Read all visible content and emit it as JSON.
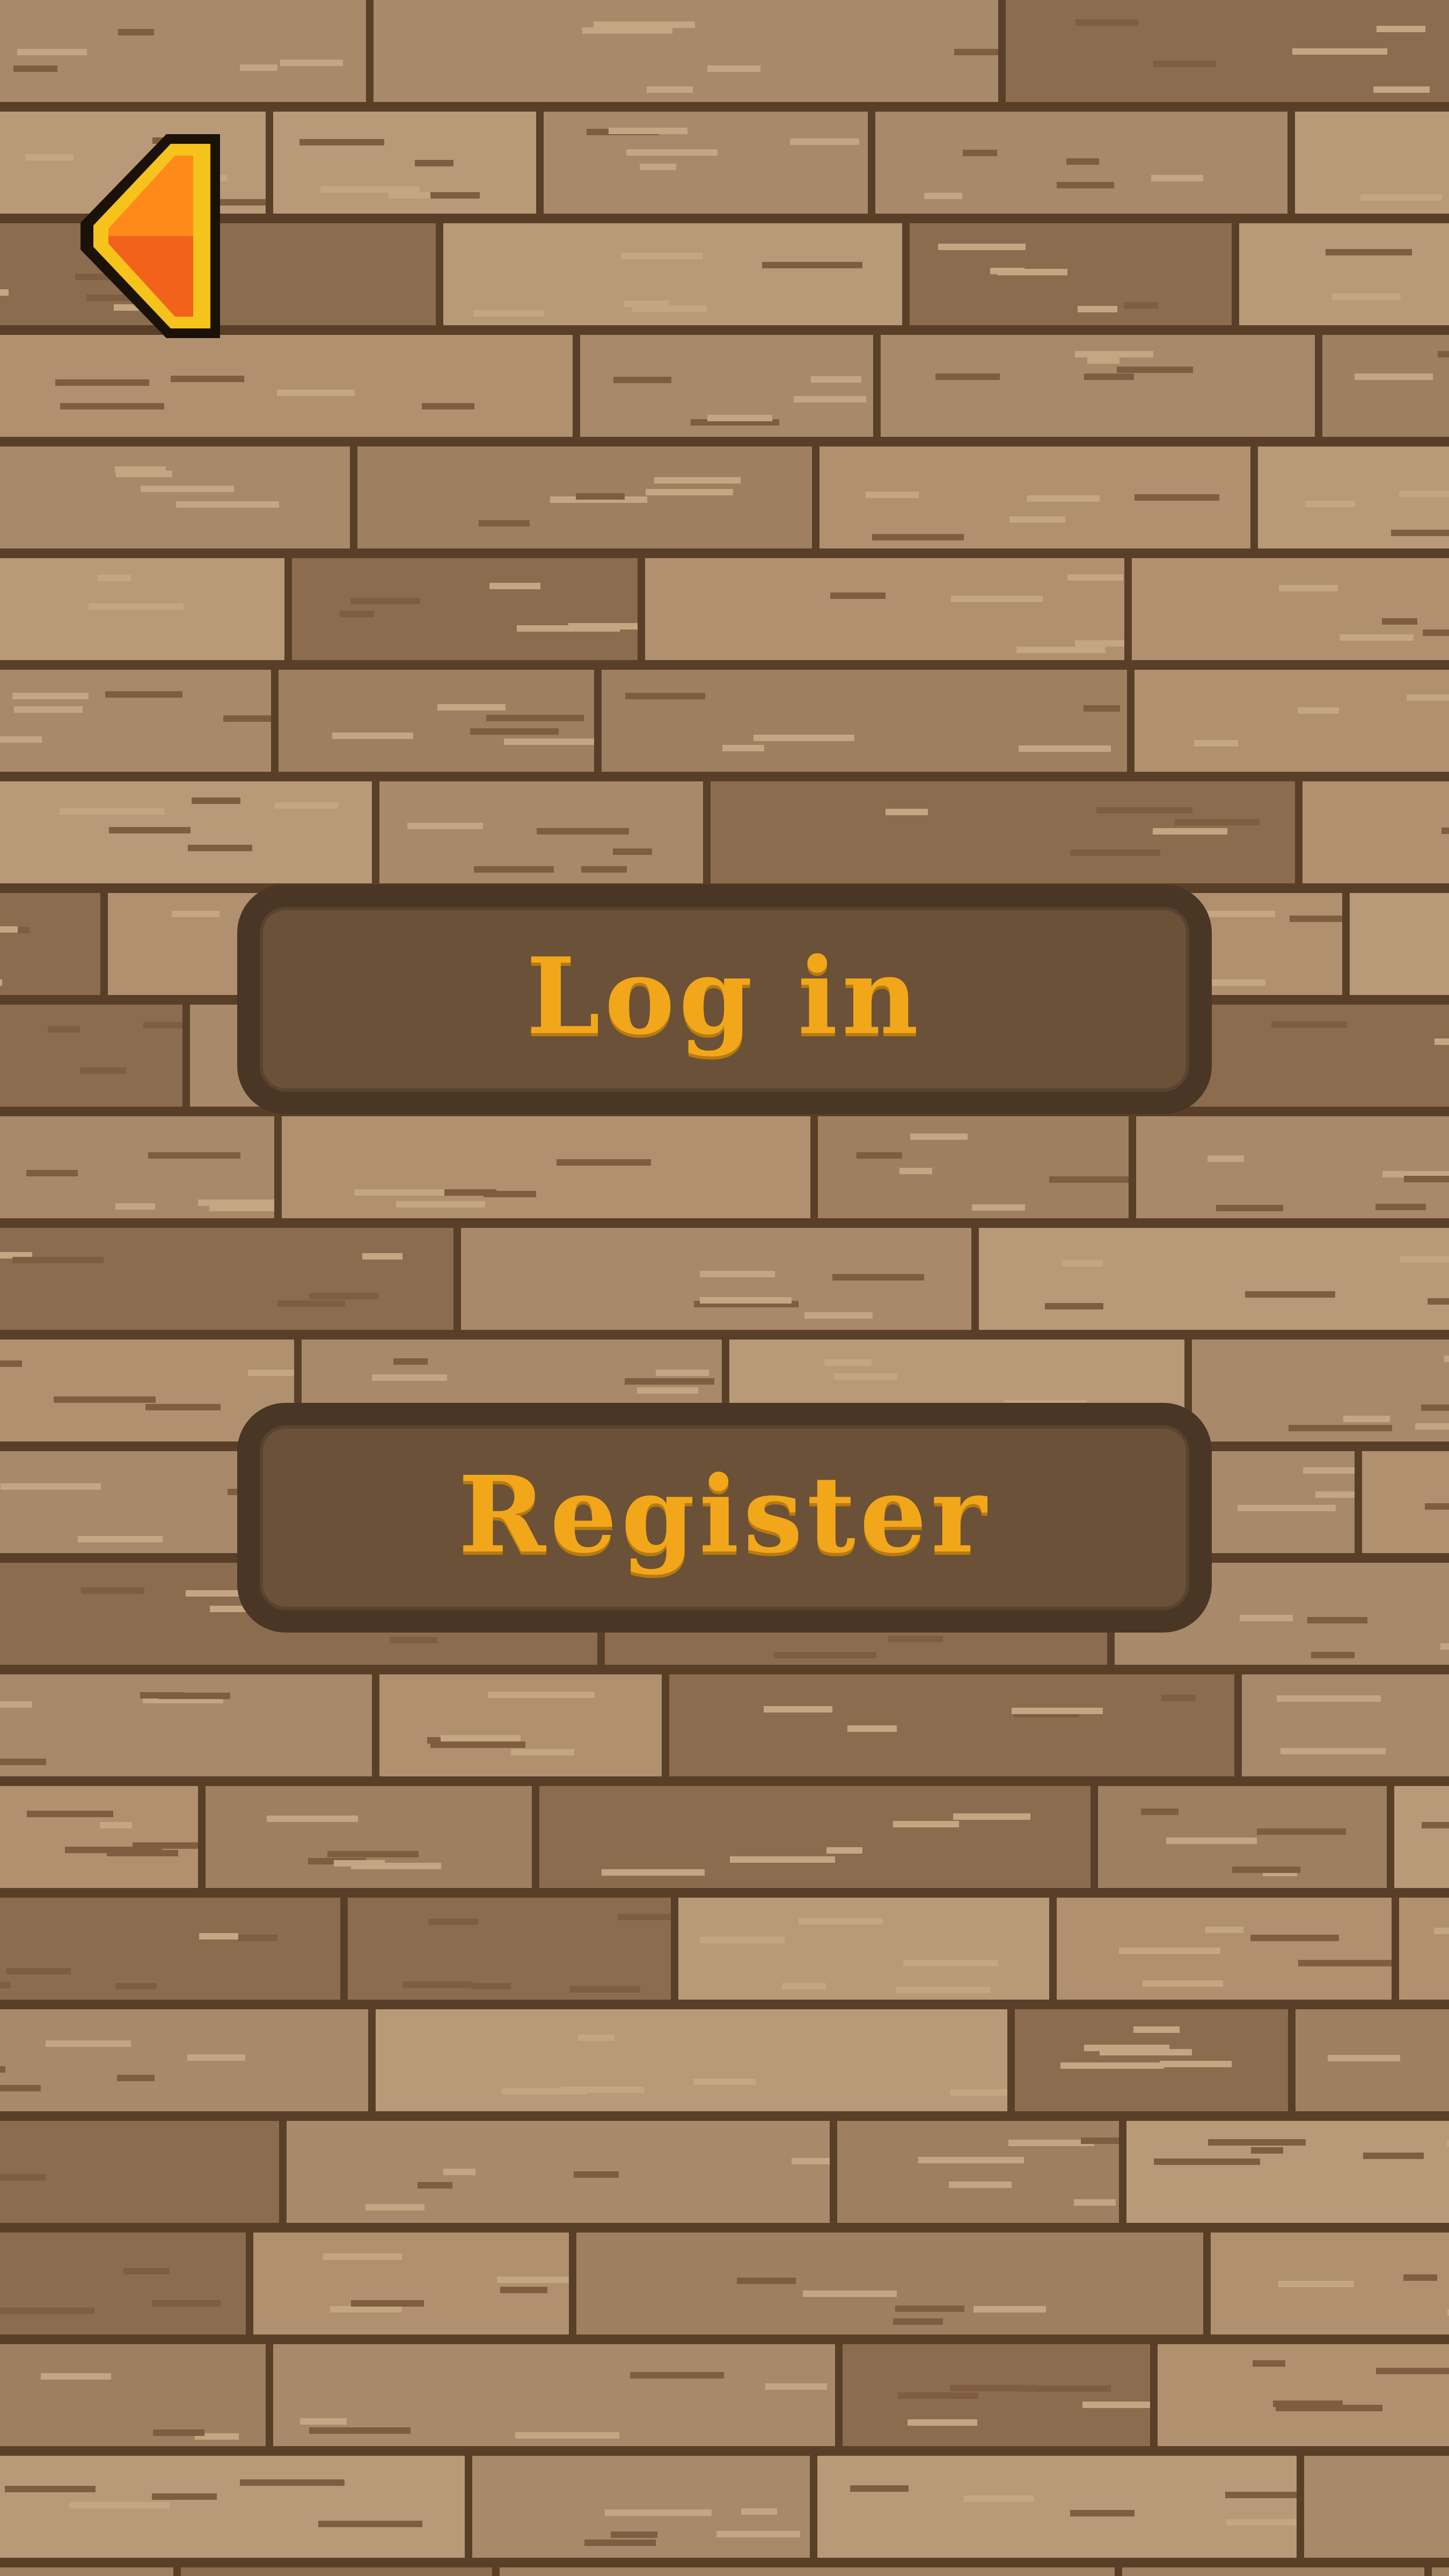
{
  "screen": {
    "name": "auth-menu"
  },
  "back_button": {
    "icon": "arrow-left-icon",
    "colors": {
      "outline": "#1a1208",
      "rim": "#f6c21c",
      "fill": "#ff8a1a",
      "fill_dark": "#f2621a"
    }
  },
  "menu": {
    "login_label": "Log in",
    "register_label": "Register"
  },
  "colors": {
    "plank": "#a8896a",
    "plank_light": "#b89a78",
    "plank_dark": "#8c6c4e",
    "seam": "#5a3f28",
    "button_fill": "#6a5138",
    "button_border": "#4a3625",
    "button_text": "#f2a71b"
  }
}
